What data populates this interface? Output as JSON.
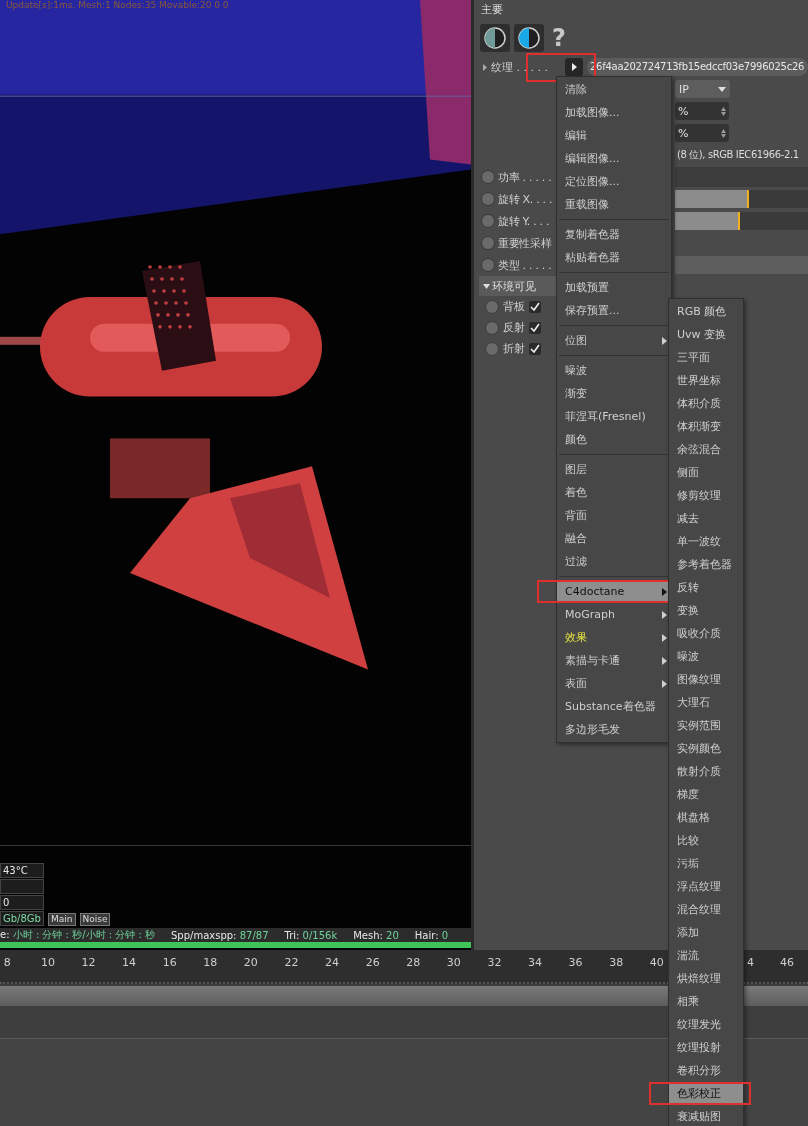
{
  "viewport": {
    "overlay_text": "Update[s]:1ms. Mesh:1 Nodes:35 Movable:20  0 0",
    "hud": [
      {
        "kind": "value",
        "text": "43°C"
      },
      {
        "kind": "blank"
      },
      {
        "kind": "value",
        "text": "0"
      },
      {
        "kind": "memory",
        "text": "Gb/8Gb"
      }
    ],
    "tabs": [
      "Main",
      "Noise"
    ],
    "status": [
      {
        "label": "e:",
        "value": "小时 : 分钟 : 秒/小时 : 分钟 : 秒"
      },
      {
        "label": "Spp/maxspp:",
        "value": "87/87"
      },
      {
        "label": "Tri:",
        "value": "0/156k"
      },
      {
        "label": "Mesh:",
        "value": "20"
      },
      {
        "label": "Hair:",
        "value": "0"
      }
    ],
    "progress": {
      "level": 1
    }
  },
  "panel": {
    "title": "主要",
    "tool_buttons": [
      {
        "kind": "half-gray"
      },
      {
        "kind": "half-blue"
      },
      {
        "kind": "help",
        "label": "?"
      }
    ],
    "texture": {
      "label": "纹理 . . . . .",
      "marked": true,
      "value": "26f4aa202724713fb15edccf03e7996025c26"
    },
    "rows": [
      {
        "kind": "dropdown",
        "value": "IP"
      },
      {
        "kind": "spinner",
        "value": "%"
      },
      {
        "kind": "spinner",
        "value": "%"
      },
      {
        "kind": "info",
        "value": "(8 位), sRGB IEC61966-2.1"
      },
      {
        "kind": "field",
        "label": "功率 . . . . .",
        "keyed": false
      },
      {
        "kind": "slider",
        "label": "旋转 X. . . .",
        "keyed": false,
        "level": 0.56
      },
      {
        "kind": "slider",
        "label": "旋转 Y. . . .",
        "keyed": false,
        "level": 0.49
      },
      {
        "kind": "plain",
        "label": "重要性采样",
        "keyed": false
      },
      {
        "kind": "bar",
        "label": "类型 . . . . .",
        "keyed": false
      }
    ],
    "group": {
      "label": "环境可见",
      "expanded": true,
      "children": [
        {
          "label": "背板",
          "keyed": false,
          "checked": true
        },
        {
          "label": "反射",
          "keyed": false,
          "checked": true
        },
        {
          "label": "折射",
          "keyed": false,
          "checked": true
        }
      ]
    }
  },
  "context_menu": {
    "sections": [
      [
        {
          "label": "清除",
          "selected": false,
          "has_submenu": false
        },
        {
          "label": "加载图像...",
          "selected": false,
          "has_submenu": false
        },
        {
          "label": "编辑",
          "selected": false,
          "has_submenu": false
        },
        {
          "label": "编辑图像...",
          "selected": false,
          "has_submenu": false
        },
        {
          "label": "定位图像...",
          "selected": false,
          "has_submenu": false
        },
        {
          "label": "重载图像",
          "selected": false,
          "has_submenu": false
        }
      ],
      [
        {
          "label": "复制着色器",
          "selected": false,
          "has_submenu": false
        },
        {
          "label": "粘贴着色器",
          "selected": false,
          "has_submenu": false
        }
      ],
      [
        {
          "label": "加载预置",
          "selected": false,
          "has_submenu": false
        },
        {
          "label": "保存预置...",
          "selected": false,
          "has_submenu": false
        }
      ],
      [
        {
          "label": "位图",
          "selected": false,
          "has_submenu": true
        }
      ],
      [
        {
          "label": "噪波",
          "selected": false,
          "has_submenu": false
        },
        {
          "label": "渐变",
          "selected": false,
          "has_submenu": false
        },
        {
          "label": "菲涅耳(Fresnel)",
          "selected": false,
          "has_submenu": false
        },
        {
          "label": "颜色",
          "selected": false,
          "has_submenu": false
        }
      ],
      [
        {
          "label": "图层",
          "selected": false,
          "has_submenu": false
        },
        {
          "label": "着色",
          "selected": false,
          "has_submenu": false
        },
        {
          "label": "背面",
          "selected": false,
          "has_submenu": false
        },
        {
          "label": "融合",
          "selected": false,
          "has_submenu": false
        },
        {
          "label": "过滤",
          "selected": false,
          "has_submenu": false
        }
      ],
      [
        {
          "label": "C4doctane",
          "selected": true,
          "has_submenu": true,
          "marked": true
        },
        {
          "label": "MoGraph",
          "selected": false,
          "has_submenu": true
        },
        {
          "label": "效果",
          "selected": false,
          "has_submenu": true,
          "emphasized": true
        },
        {
          "label": "素描与卡通",
          "selected": false,
          "has_submenu": true
        },
        {
          "label": "表面",
          "selected": false,
          "has_submenu": true
        },
        {
          "label": "Substance着色器",
          "selected": false,
          "has_submenu": false
        },
        {
          "label": "多边形毛发",
          "selected": false,
          "has_submenu": false
        }
      ]
    ]
  },
  "submenu": {
    "items": [
      {
        "label": "RGB 颜色",
        "selected": false
      },
      {
        "label": "Uvw 变换",
        "selected": false
      },
      {
        "label": "三平面",
        "selected": false
      },
      {
        "label": "世界坐标",
        "selected": false
      },
      {
        "label": "体积介质",
        "selected": false
      },
      {
        "label": "体积渐变",
        "selected": false
      },
      {
        "label": "余弦混合",
        "selected": false
      },
      {
        "label": "侧面",
        "selected": false
      },
      {
        "label": "修剪纹理",
        "selected": false
      },
      {
        "label": "减去",
        "selected": false
      },
      {
        "label": "单一波纹",
        "selected": false
      },
      {
        "label": "参考着色器",
        "selected": false
      },
      {
        "label": "反转",
        "selected": false
      },
      {
        "label": "变换",
        "selected": false
      },
      {
        "label": "吸收介质",
        "selected": false
      },
      {
        "label": "噪波",
        "selected": false
      },
      {
        "label": "图像纹理",
        "selected": false
      },
      {
        "label": "大理石",
        "selected": false
      },
      {
        "label": "实例范围",
        "selected": false
      },
      {
        "label": "实例颜色",
        "selected": false
      },
      {
        "label": "散射介质",
        "selected": false
      },
      {
        "label": "梯度",
        "selected": false
      },
      {
        "label": "棋盘格",
        "selected": false
      },
      {
        "label": "比较",
        "selected": false
      },
      {
        "label": "污垢",
        "selected": false
      },
      {
        "label": "浮点纹理",
        "selected": false
      },
      {
        "label": "混合纹理",
        "selected": false
      },
      {
        "label": "添加",
        "selected": false
      },
      {
        "label": "湍流",
        "selected": false
      },
      {
        "label": "烘焙纹理",
        "selected": false
      },
      {
        "label": "相乘",
        "selected": false
      },
      {
        "label": "纹理发光",
        "selected": false
      },
      {
        "label": "纹理投射",
        "selected": false
      },
      {
        "label": "卷积分形",
        "selected": false
      },
      {
        "label": "色彩校正",
        "selected": true,
        "marked": true
      },
      {
        "label": "衰减贴图",
        "selected": false
      }
    ]
  },
  "timeline": {
    "left_labels": [
      "8",
      "10",
      "12",
      "14",
      "16",
      "18",
      "20",
      "22",
      "24",
      "26",
      "28",
      "30",
      "32",
      "34",
      "36",
      "38",
      "40"
    ],
    "right_labels": [
      "4",
      "46"
    ]
  }
}
